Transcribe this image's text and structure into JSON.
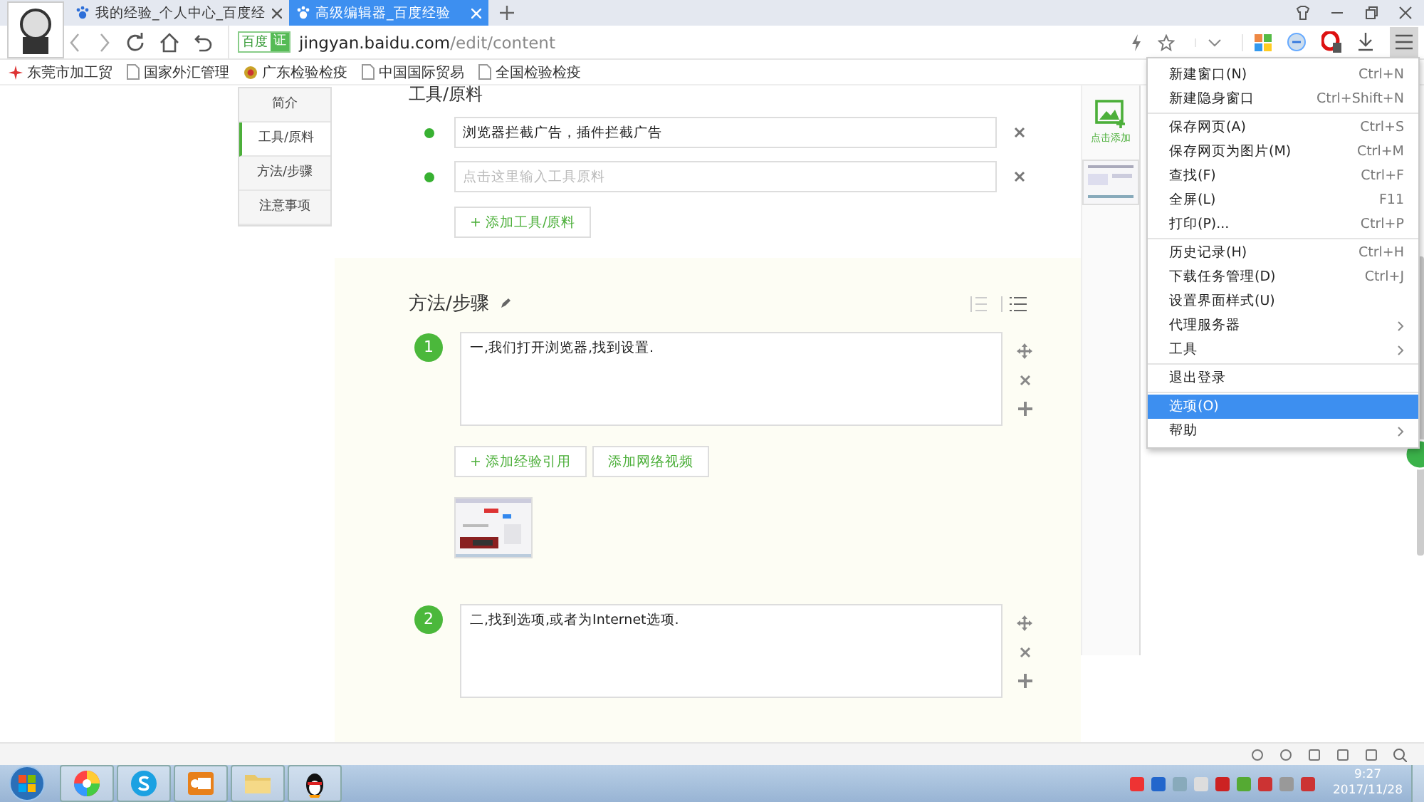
{
  "tabs": [
    {
      "title": "我的经验_个人中心_百度经",
      "selected": false
    },
    {
      "title": "高级编辑器_百度经验",
      "selected": true
    }
  ],
  "address": {
    "site_badge": "百度",
    "verified_badge": "证",
    "host": "jingyan.baidu.com",
    "path": "/edit/content"
  },
  "bookmarks": [
    {
      "label": "东莞市加工贸",
      "kind": "brand"
    },
    {
      "label": "国家外汇管理",
      "kind": "page"
    },
    {
      "label": "广东检验检疫",
      "kind": "emblem"
    },
    {
      "label": "中国国际贸易",
      "kind": "page"
    },
    {
      "label": "全国检验检疫",
      "kind": "page"
    }
  ],
  "side_nav": [
    {
      "label": "简介",
      "selected": false
    },
    {
      "label": "工具/原料",
      "selected": true
    },
    {
      "label": "方法/步骤",
      "selected": false
    },
    {
      "label": "注意事项",
      "selected": false
    }
  ],
  "tools": {
    "heading": "工具/原料",
    "items": [
      {
        "value": "浏览器拦截广告，插件拦截广告"
      },
      {
        "placeholder": "点击这里输入工具原料"
      }
    ],
    "add_button": "+ 添加工具/原料"
  },
  "steps": {
    "heading": "方法/步骤",
    "items": [
      {
        "number": "1",
        "text": "一,我们打开浏览器,找到设置.",
        "buttons": [
          "+ 添加经验引用",
          "添加网络视频"
        ]
      },
      {
        "number": "2",
        "text": "二,找到选项,或者为Internet选项."
      }
    ]
  },
  "right_panel": {
    "label": "点击添加"
  },
  "menu": {
    "groups": [
      {
        "items": [
          {
            "label": "新建窗口(N)",
            "shortcut": "Ctrl+N",
            "submenu": false,
            "selected": false
          },
          {
            "label": "新建隐身窗口",
            "shortcut": "Ctrl+Shift+N",
            "submenu": false,
            "selected": false
          }
        ]
      },
      {
        "items": [
          {
            "label": "保存网页(A)",
            "shortcut": "Ctrl+S",
            "submenu": false,
            "selected": false
          },
          {
            "label": "保存网页为图片(M)",
            "shortcut": "Ctrl+M",
            "submenu": false,
            "selected": false
          },
          {
            "label": "查找(F)",
            "shortcut": "Ctrl+F",
            "submenu": false,
            "selected": false
          },
          {
            "label": "全屏(L)",
            "shortcut": "F11",
            "submenu": false,
            "selected": false
          },
          {
            "label": "打印(P)...",
            "shortcut": "Ctrl+P",
            "submenu": false,
            "selected": false
          }
        ]
      },
      {
        "items": [
          {
            "label": "历史记录(H)",
            "shortcut": "Ctrl+H",
            "submenu": false,
            "selected": false
          },
          {
            "label": "下载任务管理(D)",
            "shortcut": "Ctrl+J",
            "submenu": false,
            "selected": false
          },
          {
            "label": "设置界面样式(U)",
            "submenu": false,
            "selected": false
          },
          {
            "label": "代理服务器",
            "submenu": true,
            "selected": false
          },
          {
            "label": "工具",
            "submenu": true,
            "selected": false
          }
        ]
      },
      {
        "items": [
          {
            "label": "退出登录",
            "submenu": false,
            "selected": false
          }
        ]
      },
      {
        "items": [
          {
            "label": "选项(O)",
            "submenu": false,
            "selected": true
          },
          {
            "label": "帮助",
            "submenu": true,
            "selected": false
          }
        ]
      }
    ]
  },
  "taskbar": {
    "time": "9:27",
    "date": "2017/11/28"
  }
}
